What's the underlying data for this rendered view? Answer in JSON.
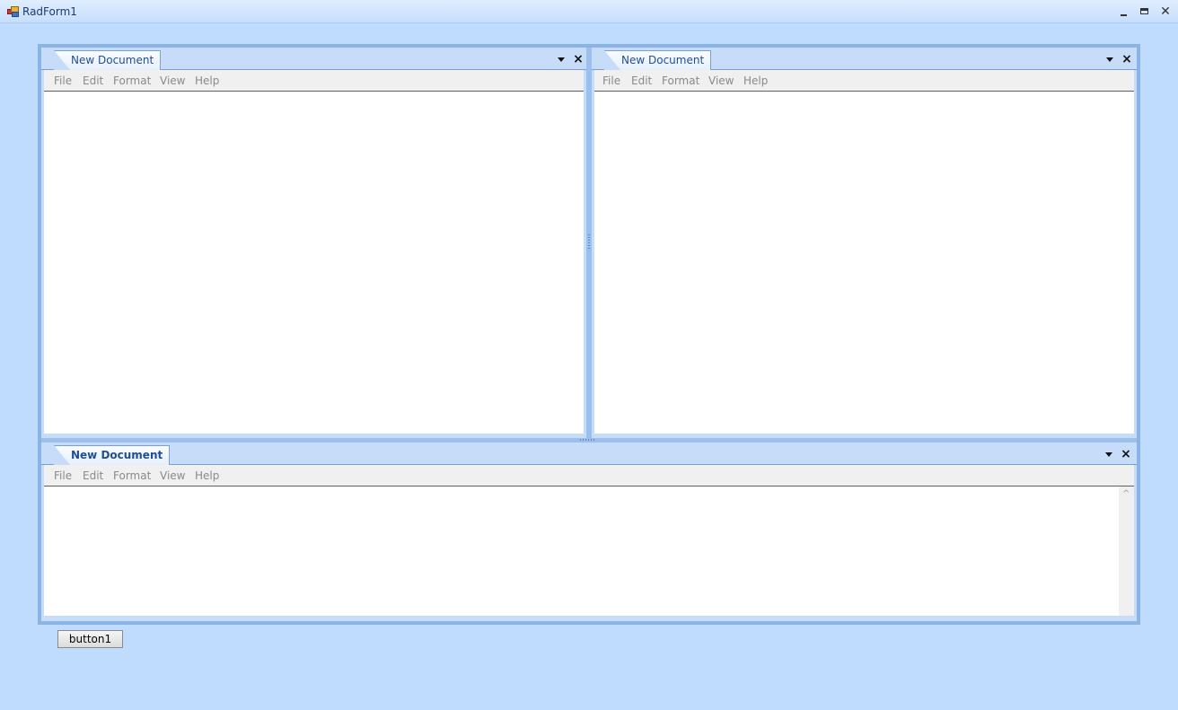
{
  "window": {
    "title": "RadForm1",
    "minimize_icon": "minimize-icon",
    "maximize_icon": "maximize-icon",
    "close_icon": "close-icon"
  },
  "panes": [
    {
      "tab_label": "New Document",
      "active": false,
      "menu": [
        "File",
        "Edit",
        "Format",
        "View",
        "Help"
      ]
    },
    {
      "tab_label": "New Document",
      "active": false,
      "menu": [
        "File",
        "Edit",
        "Format",
        "View",
        "Help"
      ]
    },
    {
      "tab_label": "New Document",
      "active": true,
      "menu": [
        "File",
        "Edit",
        "Format",
        "View",
        "Help"
      ]
    }
  ],
  "button1": {
    "label": "button1"
  },
  "colors": {
    "form_background": "#bfdbfe",
    "tab_text": "#1f4e96",
    "menu_text": "#8a8a8a"
  }
}
